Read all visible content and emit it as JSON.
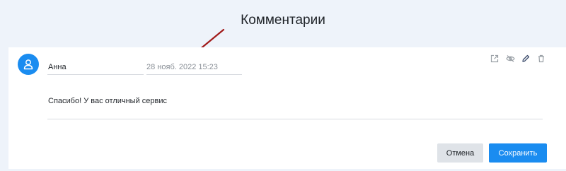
{
  "page": {
    "title": "Комментарии"
  },
  "comment": {
    "author": "Анна",
    "date": "28 нояб. 2022 15:23",
    "text": "Спасибо! У вас отличный сервис"
  },
  "toolbar": {
    "icons": [
      "external-link-icon",
      "eye-off-icon",
      "pencil-icon",
      "trash-icon"
    ],
    "icon_color": "#9aa0a6"
  },
  "actions": {
    "cancel_label": "Отмена",
    "save_label": "Сохранить"
  },
  "colors": {
    "accent": "#1a8cf0",
    "annotation_arrow": "#a11a1a",
    "background": "#eef3fa"
  }
}
